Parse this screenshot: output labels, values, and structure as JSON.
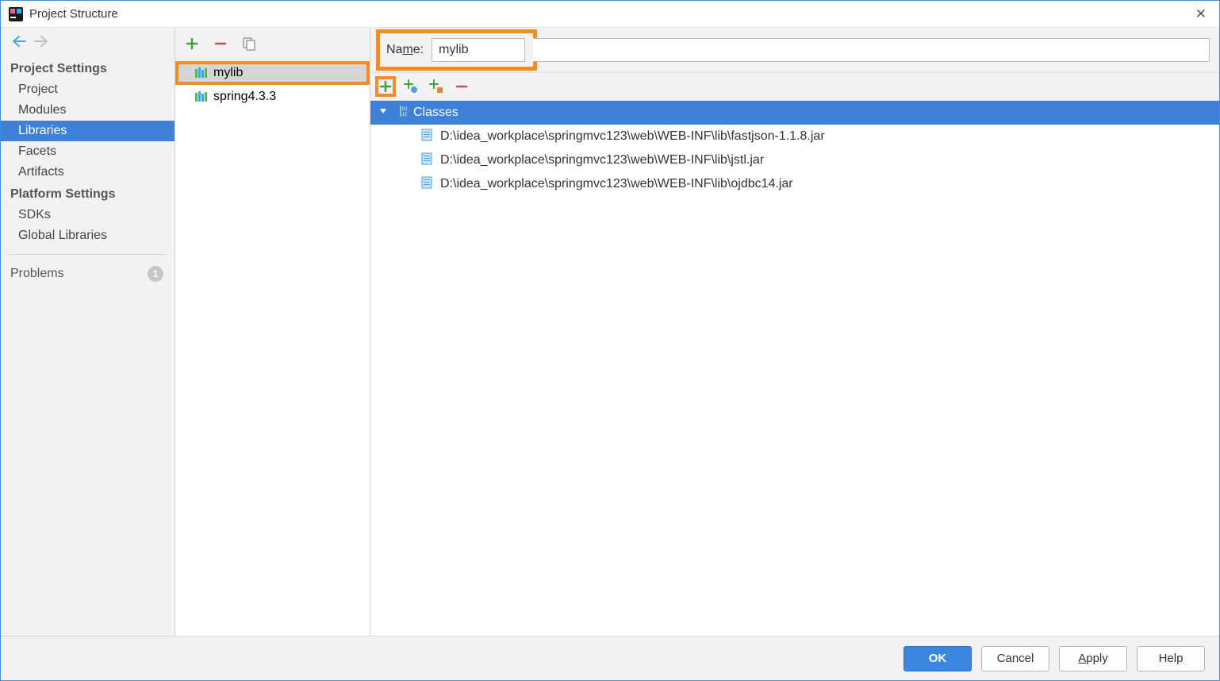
{
  "title": "Project Structure",
  "sidebar": {
    "sections": [
      {
        "title": "Project Settings",
        "items": [
          "Project",
          "Modules",
          "Libraries",
          "Facets",
          "Artifacts"
        ],
        "selected": "Libraries"
      },
      {
        "title": "Platform Settings",
        "items": [
          "SDKs",
          "Global Libraries"
        ]
      }
    ],
    "problems": {
      "label": "Problems",
      "count": "1"
    }
  },
  "libs": {
    "items": [
      {
        "name": "mylib",
        "selected": true
      },
      {
        "name": "spring4.3.3",
        "selected": false
      }
    ]
  },
  "detail": {
    "name_label_pre": "Na",
    "name_label_u": "m",
    "name_label_post": "e:",
    "name_value": "mylib",
    "classes_header": "Classes",
    "files": [
      "D:\\idea_workplace\\springmvc123\\web\\WEB-INF\\lib\\fastjson-1.1.8.jar",
      "D:\\idea_workplace\\springmvc123\\web\\WEB-INF\\lib\\jstl.jar",
      "D:\\idea_workplace\\springmvc123\\web\\WEB-INF\\lib\\ojdbc14.jar"
    ]
  },
  "footer": {
    "ok": "OK",
    "cancel": "Cancel",
    "apply_pre": "",
    "apply_u": "A",
    "apply_post": "pply",
    "help": "Help"
  }
}
